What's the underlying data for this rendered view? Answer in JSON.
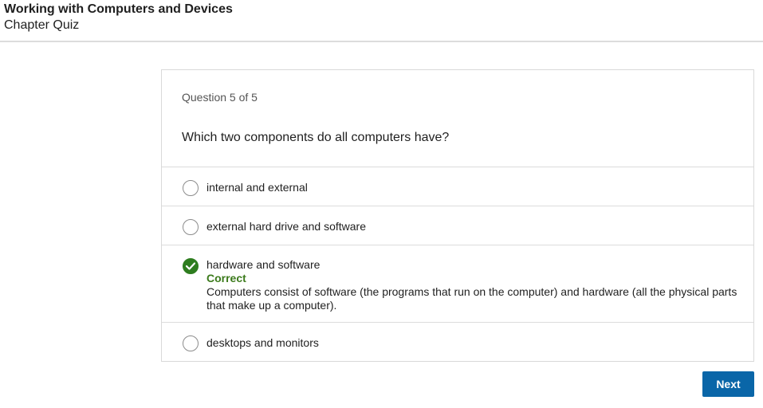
{
  "header": {
    "course_title": "Working with Computers and Devices",
    "quiz_title": "Chapter Quiz"
  },
  "quiz": {
    "counter": "Question 5 of 5",
    "question": "Which two components do all computers have?",
    "options": [
      {
        "label": "internal and external",
        "state": "unselected"
      },
      {
        "label": "external hard drive and software",
        "state": "unselected"
      },
      {
        "label": "hardware and software",
        "state": "correct",
        "feedback_status": "Correct",
        "feedback_text": "Computers consist of software (the programs that run on the computer) and hardware (all the physical parts that make up a computer)."
      },
      {
        "label": "desktops and monitors",
        "state": "unselected"
      }
    ]
  },
  "actions": {
    "next_label": "Next"
  },
  "colors": {
    "correct": "#2e7d1f",
    "primary_button": "#0a66a8"
  }
}
